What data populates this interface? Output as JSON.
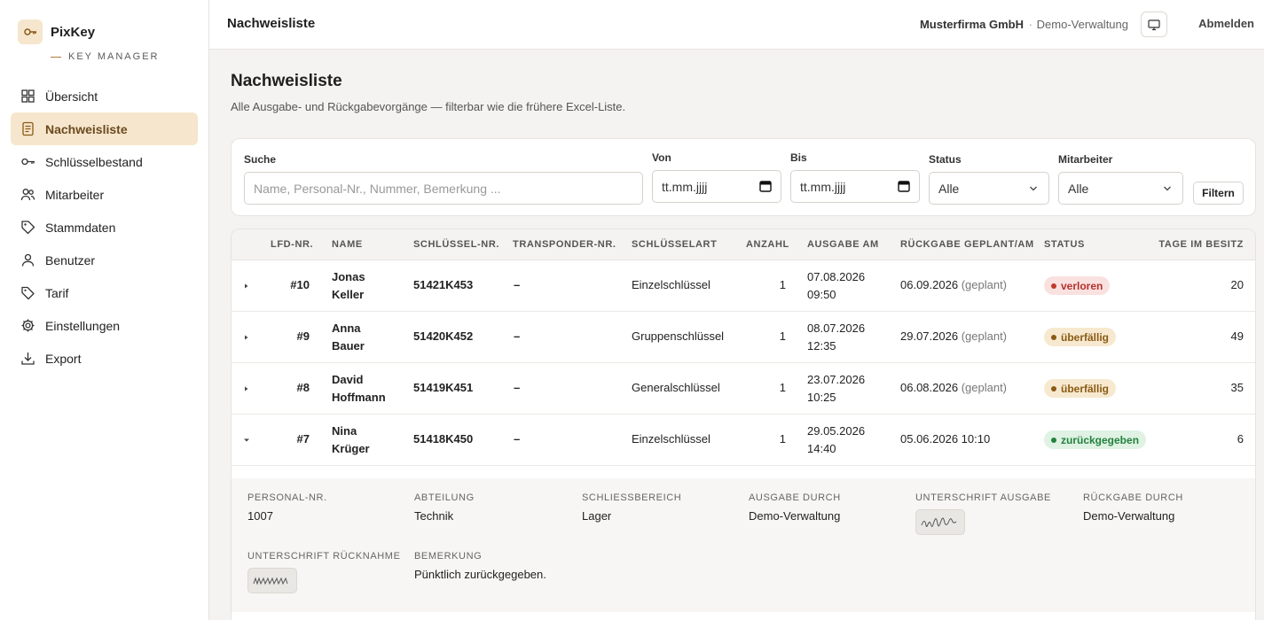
{
  "app": {
    "name": "PixKey",
    "tagline": "KEY MANAGER",
    "accent": "#f6e6cd",
    "accent_text": "#6b4a1e"
  },
  "sidebar": {
    "items": [
      {
        "label": "Übersicht",
        "icon": "grid-icon",
        "active": false
      },
      {
        "label": "Nachweisliste",
        "icon": "document-icon",
        "active": true
      },
      {
        "label": "Schlüsselbestand",
        "icon": "key-icon",
        "active": false
      },
      {
        "label": "Mitarbeiter",
        "icon": "users-icon",
        "active": false
      },
      {
        "label": "Stammdaten",
        "icon": "tag-icon",
        "active": false
      },
      {
        "label": "Benutzer",
        "icon": "user-icon",
        "active": false
      },
      {
        "label": "Tarif",
        "icon": "price-tag-icon",
        "active": false
      },
      {
        "label": "Einstellungen",
        "icon": "gear-icon",
        "active": false
      },
      {
        "label": "Export",
        "icon": "download-icon",
        "active": false
      }
    ]
  },
  "header": {
    "title": "Nachweisliste",
    "company": "Musterfirma GmbH",
    "separator": "·",
    "role": "Demo-Verwaltung",
    "logout": "Abmelden"
  },
  "main": {
    "title": "Nachweisliste",
    "subtitle": "Alle Ausgabe- und Rückgabevorgänge — filterbar wie die frühere Excel-Liste."
  },
  "filters": {
    "search_label": "Suche",
    "search_placeholder": "Name, Personal-Nr., Nummer, Bemerkung ...",
    "from_label": "Von",
    "from_value": "tt.mm.jjjj",
    "to_label": "Bis",
    "to_value": "tt.mm.jjjj",
    "status_label": "Status",
    "status_value": "Alle",
    "employee_label": "Mitarbeiter",
    "employee_value": "Alle",
    "filter_button": "Filtern"
  },
  "table": {
    "columns": [
      "LFD-NR.",
      "NAME",
      "SCHLÜSSEL-NR.",
      "TRANSPONDER-NR.",
      "SCHLÜSSELART",
      "ANZAHL",
      "AUSGABE AM",
      "RÜCKGABE GEPLANT/AM",
      "STATUS",
      "TAGE IM BESITZ"
    ],
    "rows": [
      {
        "nr": "#10",
        "first": "Jonas",
        "last": "Keller",
        "key": "51421K453",
        "transponder": "–",
        "type": "Einzelschlüssel",
        "count": "1",
        "issue_date": "07.08.2026",
        "issue_time": "09:50",
        "return": "06.09.2026",
        "return_note": "(geplant)",
        "status": "verloren",
        "days": "20",
        "expanded": false
      },
      {
        "nr": "#9",
        "first": "Anna",
        "last": "Bauer",
        "key": "51420K452",
        "transponder": "–",
        "type": "Gruppenschlüssel",
        "count": "1",
        "issue_date": "08.07.2026",
        "issue_time": "12:35",
        "return": "29.07.2026",
        "return_note": "(geplant)",
        "status": "überfällig",
        "days": "49",
        "expanded": false
      },
      {
        "nr": "#8",
        "first": "David",
        "last": "Hoffmann",
        "key": "51419K451",
        "transponder": "–",
        "type": "Generalschlüssel",
        "count": "1",
        "issue_date": "23.07.2026",
        "issue_time": "10:25",
        "return": "06.08.2026",
        "return_note": "(geplant)",
        "status": "überfällig",
        "days": "35",
        "expanded": false
      },
      {
        "nr": "#7",
        "first": "Nina",
        "last": "Krüger",
        "key": "51418K450",
        "transponder": "–",
        "type": "Einzelschlüssel",
        "count": "1",
        "issue_date": "29.05.2026",
        "issue_time": "14:40",
        "return": "05.06.2026 10:10",
        "return_note": "",
        "status": "zurückgegeben",
        "days": "6",
        "expanded": true
      }
    ],
    "status_colors": {
      "verloren": "#c0392b",
      "überfällig": "#8a5a14",
      "zurückgegeben": "#23813e"
    }
  },
  "detail": {
    "personal_label": "PERSONAL-NR.",
    "personal_value": "1007",
    "dept_label": "ABTEILUNG",
    "dept_value": "Technik",
    "area_label": "SCHLIESSBEREICH",
    "area_value": "Lager",
    "issued_by_label": "AUSGABE DURCH",
    "issued_by_value": "Demo-Verwaltung",
    "sig_issue_label": "UNTERSCHRIFT AUSGABE",
    "returned_by_label": "RÜCKGABE DURCH",
    "returned_by_value": "Demo-Verwaltung",
    "sig_return_label": "UNTERSCHRIFT RÜCKNAHME",
    "note_label": "BEMERKUNG",
    "note_value": "Pünktlich zurückgegeben."
  }
}
